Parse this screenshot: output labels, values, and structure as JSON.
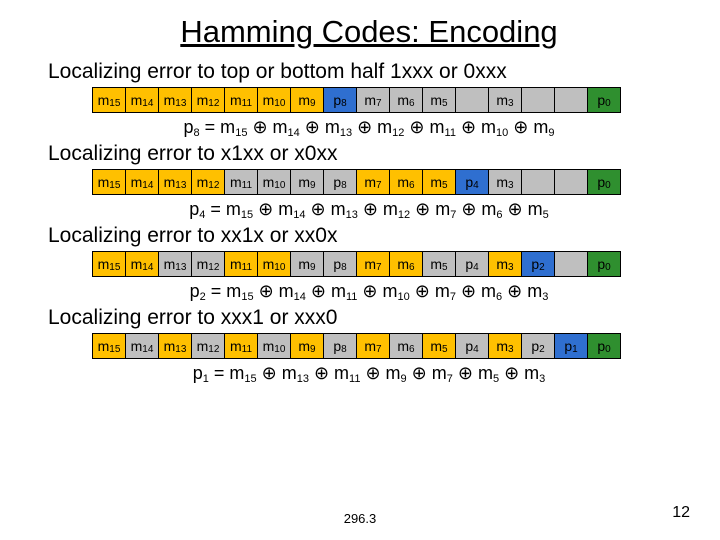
{
  "title": "Hamming Codes: Encoding",
  "rows": [
    {
      "localize": "Localizing error to top or bottom half 1xxx or 0xxx",
      "cells": [
        {
          "t": "m",
          "s": "15",
          "c": "yellow"
        },
        {
          "t": "m",
          "s": "14",
          "c": "yellow"
        },
        {
          "t": "m",
          "s": "13",
          "c": "yellow"
        },
        {
          "t": "m",
          "s": "12",
          "c": "yellow"
        },
        {
          "t": "m",
          "s": "11",
          "c": "yellow"
        },
        {
          "t": "m",
          "s": "10",
          "c": "yellow"
        },
        {
          "t": "m",
          "s": "9",
          "c": "yellow"
        },
        {
          "t": "p",
          "s": "8",
          "c": "blue"
        },
        {
          "t": "m",
          "s": "7",
          "c": "gray"
        },
        {
          "t": "m",
          "s": "6",
          "c": "gray"
        },
        {
          "t": "m",
          "s": "5",
          "c": "gray"
        },
        {
          "t": "",
          "s": "",
          "c": "gray"
        },
        {
          "t": "m",
          "s": "3",
          "c": "gray"
        },
        {
          "t": "",
          "s": "",
          "c": "gray"
        },
        {
          "t": "",
          "s": "",
          "c": "gray"
        },
        {
          "t": "p",
          "s": "0",
          "c": "green"
        }
      ],
      "eq": "p₈ = m₁₅ ⊕ m₁₄ ⊕ m₁₃ ⊕ m₁₂ ⊕ m₁₁ ⊕ m₁₀ ⊕ m₉"
    },
    {
      "localize": "Localizing error to x1xx or x0xx",
      "cells": [
        {
          "t": "m",
          "s": "15",
          "c": "yellow"
        },
        {
          "t": "m",
          "s": "14",
          "c": "yellow"
        },
        {
          "t": "m",
          "s": "13",
          "c": "yellow"
        },
        {
          "t": "m",
          "s": "12",
          "c": "yellow"
        },
        {
          "t": "m",
          "s": "11",
          "c": "gray"
        },
        {
          "t": "m",
          "s": "10",
          "c": "gray"
        },
        {
          "t": "m",
          "s": "9",
          "c": "gray"
        },
        {
          "t": "p",
          "s": "8",
          "c": "gray"
        },
        {
          "t": "m",
          "s": "7",
          "c": "yellow"
        },
        {
          "t": "m",
          "s": "6",
          "c": "yellow"
        },
        {
          "t": "m",
          "s": "5",
          "c": "yellow"
        },
        {
          "t": "p",
          "s": "4",
          "c": "blue"
        },
        {
          "t": "m",
          "s": "3",
          "c": "gray"
        },
        {
          "t": "",
          "s": "",
          "c": "gray"
        },
        {
          "t": "",
          "s": "",
          "c": "gray"
        },
        {
          "t": "p",
          "s": "0",
          "c": "green"
        }
      ],
      "eq": "p₄ = m₁₅ ⊕ m₁₄ ⊕ m₁₃ ⊕ m₁₂ ⊕ m₇ ⊕ m₆ ⊕ m₅"
    },
    {
      "localize": "Localizing error to xx1x or xx0x",
      "cells": [
        {
          "t": "m",
          "s": "15",
          "c": "yellow"
        },
        {
          "t": "m",
          "s": "14",
          "c": "yellow"
        },
        {
          "t": "m",
          "s": "13",
          "c": "gray"
        },
        {
          "t": "m",
          "s": "12",
          "c": "gray"
        },
        {
          "t": "m",
          "s": "11",
          "c": "yellow"
        },
        {
          "t": "m",
          "s": "10",
          "c": "yellow"
        },
        {
          "t": "m",
          "s": "9",
          "c": "gray"
        },
        {
          "t": "p",
          "s": "8",
          "c": "gray"
        },
        {
          "t": "m",
          "s": "7",
          "c": "yellow"
        },
        {
          "t": "m",
          "s": "6",
          "c": "yellow"
        },
        {
          "t": "m",
          "s": "5",
          "c": "gray"
        },
        {
          "t": "p",
          "s": "4",
          "c": "gray"
        },
        {
          "t": "m",
          "s": "3",
          "c": "yellow"
        },
        {
          "t": "p",
          "s": "2",
          "c": "blue"
        },
        {
          "t": "",
          "s": "",
          "c": "gray"
        },
        {
          "t": "p",
          "s": "0",
          "c": "green"
        }
      ],
      "eq": "p₂ = m₁₅ ⊕ m₁₄ ⊕ m₁₁ ⊕ m₁₀ ⊕ m₇ ⊕ m₆ ⊕ m₃"
    },
    {
      "localize": "Localizing error to xxx1 or xxx0",
      "cells": [
        {
          "t": "m",
          "s": "15",
          "c": "yellow"
        },
        {
          "t": "m",
          "s": "14",
          "c": "gray"
        },
        {
          "t": "m",
          "s": "13",
          "c": "yellow"
        },
        {
          "t": "m",
          "s": "12",
          "c": "gray"
        },
        {
          "t": "m",
          "s": "11",
          "c": "yellow"
        },
        {
          "t": "m",
          "s": "10",
          "c": "gray"
        },
        {
          "t": "m",
          "s": "9",
          "c": "yellow"
        },
        {
          "t": "p",
          "s": "8",
          "c": "gray"
        },
        {
          "t": "m",
          "s": "7",
          "c": "yellow"
        },
        {
          "t": "m",
          "s": "6",
          "c": "gray"
        },
        {
          "t": "m",
          "s": "5",
          "c": "yellow"
        },
        {
          "t": "p",
          "s": "4",
          "c": "gray"
        },
        {
          "t": "m",
          "s": "3",
          "c": "yellow"
        },
        {
          "t": "p",
          "s": "2",
          "c": "gray"
        },
        {
          "t": "p",
          "s": "1",
          "c": "blue"
        },
        {
          "t": "p",
          "s": "0",
          "c": "green"
        }
      ],
      "eq": "p₁ = m₁₅ ⊕ m₁₃ ⊕ m₁₁ ⊕ m₉ ⊕ m₇ ⊕ m₅ ⊕ m₃"
    }
  ],
  "course": "296.3",
  "page": "12"
}
